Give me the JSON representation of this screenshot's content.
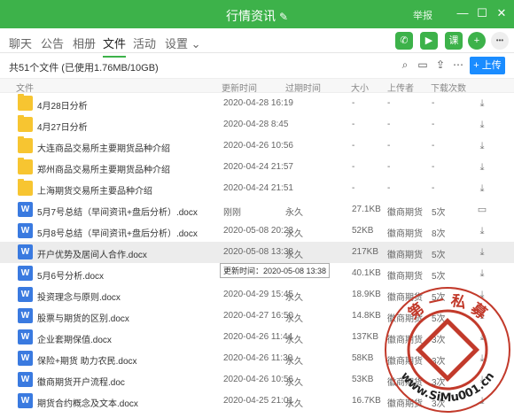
{
  "titlebar": {
    "title": "行情资讯",
    "edit_glyph": "✎",
    "report": "举报",
    "minimize": "—",
    "maximize": "☐",
    "close": "✕"
  },
  "tabs": [
    "聊天",
    "公告",
    "相册",
    "文件",
    "活动",
    "设置"
  ],
  "active_tab": "文件",
  "settings_chevron": "⌄",
  "tab_icons": [
    {
      "name": "phone-icon",
      "glyph": "✆",
      "color": "#3db24a"
    },
    {
      "name": "video-icon",
      "glyph": "▶",
      "color": "#3db24a"
    },
    {
      "name": "course-icon",
      "glyph": "课",
      "color": "#3db24a"
    },
    {
      "name": "add-icon",
      "glyph": "+",
      "color": "#3db24a"
    },
    {
      "name": "more-icon",
      "glyph": "•••",
      "color": "#7a7a7a"
    }
  ],
  "toolbar": {
    "summary": "共51个文件 (已使用1.76MB/10GB)",
    "upload_label": "+ 上传",
    "icons": [
      "search-icon",
      "folder-open-icon",
      "upload-box-icon",
      "more-icon"
    ]
  },
  "columns": [
    "文件",
    "更新时间",
    "过期时间",
    "大小",
    "上传者",
    "下载次数"
  ],
  "rows": [
    {
      "type": "folder",
      "name": "4月28日分析",
      "updated": "2020-04-28 16:19",
      "expire": "",
      "size": "-",
      "uploader": "-",
      "downloads": "-",
      "action": "⤓"
    },
    {
      "type": "folder",
      "name": "4月27日分析",
      "updated": "2020-04-28 8:45",
      "expire": "",
      "size": "-",
      "uploader": "-",
      "downloads": "-",
      "action": "⤓"
    },
    {
      "type": "folder",
      "name": "大连商品交易所主要期货品种介绍",
      "updated": "2020-04-26 10:56",
      "expire": "",
      "size": "-",
      "uploader": "-",
      "downloads": "-",
      "action": "⤓"
    },
    {
      "type": "folder",
      "name": "郑州商品交易所主要期货品种介绍",
      "updated": "2020-04-24 21:57",
      "expire": "",
      "size": "-",
      "uploader": "-",
      "downloads": "-",
      "action": "⤓"
    },
    {
      "type": "folder",
      "name": "上海期货交易所主要品种介绍",
      "updated": "2020-04-24 21:51",
      "expire": "",
      "size": "-",
      "uploader": "-",
      "downloads": "-",
      "action": "⤓"
    },
    {
      "type": "word",
      "name": "5月7号总结（早间资讯+盘后分析）.docx",
      "updated": "刚刚",
      "expire": "永久",
      "size": "27.1KB",
      "uploader": "徽商期货",
      "downloads": "5次",
      "action": "▭"
    },
    {
      "type": "word",
      "name": "5月8号总结（早间资讯+盘后分析）.docx",
      "updated": "2020-05-08 20:23",
      "expire": "永久",
      "size": "52KB",
      "uploader": "徽商期货",
      "downloads": "8次",
      "action": "⤓"
    },
    {
      "type": "word",
      "name": "开户优势及居间人合作.docx",
      "updated": "2020-05-08 13:38",
      "expire": "永久",
      "size": "217KB",
      "uploader": "徽商期货",
      "downloads": "5次",
      "action": "⤓"
    },
    {
      "type": "word",
      "name": "5月6号分析.docx",
      "updated": "",
      "expire": "",
      "size": "40.1KB",
      "uploader": "徽商期货",
      "downloads": "5次",
      "action": "⤓"
    },
    {
      "type": "word",
      "name": "投资理念与原则.docx",
      "updated": "2020-04-29 15:45",
      "expire": "永久",
      "size": "18.9KB",
      "uploader": "徽商期货",
      "downloads": "5次",
      "action": "⤓"
    },
    {
      "type": "word",
      "name": "股票与期货的区别.docx",
      "updated": "2020-04-27 16:50",
      "expire": "永久",
      "size": "14.8KB",
      "uploader": "徽商期货",
      "downloads": "5次",
      "action": "⤓"
    },
    {
      "type": "word",
      "name": "企业套期保值.docx",
      "updated": "2020-04-26 11:44",
      "expire": "永久",
      "size": "137KB",
      "uploader": "徽商期货",
      "downloads": "3次",
      "action": "⤓"
    },
    {
      "type": "word",
      "name": "保险+期货 助力农民.docx",
      "updated": "2020-04-26 11:30",
      "expire": "永久",
      "size": "58KB",
      "uploader": "徽商期货",
      "downloads": "3次",
      "action": "⤓"
    },
    {
      "type": "word",
      "name": "徽商期货开户流程.doc",
      "updated": "2020-04-26 10:56",
      "expire": "永久",
      "size": "53KB",
      "uploader": "徽商期货",
      "downloads": "3次",
      "action": "⤓"
    },
    {
      "type": "word",
      "name": "期货合约概念及文本.docx",
      "updated": "2020-04-25 21:01",
      "expire": "永久",
      "size": "16.7KB",
      "uploader": "徽商期货",
      "downloads": "3次",
      "action": "⤓"
    }
  ],
  "highlight_row": 7,
  "tooltip": "更新时间：2020-05-08 13:38",
  "watermark": {
    "top_text": "第 一 私 募",
    "bottom_text": "www.SiMu001.cn",
    "color": "#c23a2b"
  }
}
